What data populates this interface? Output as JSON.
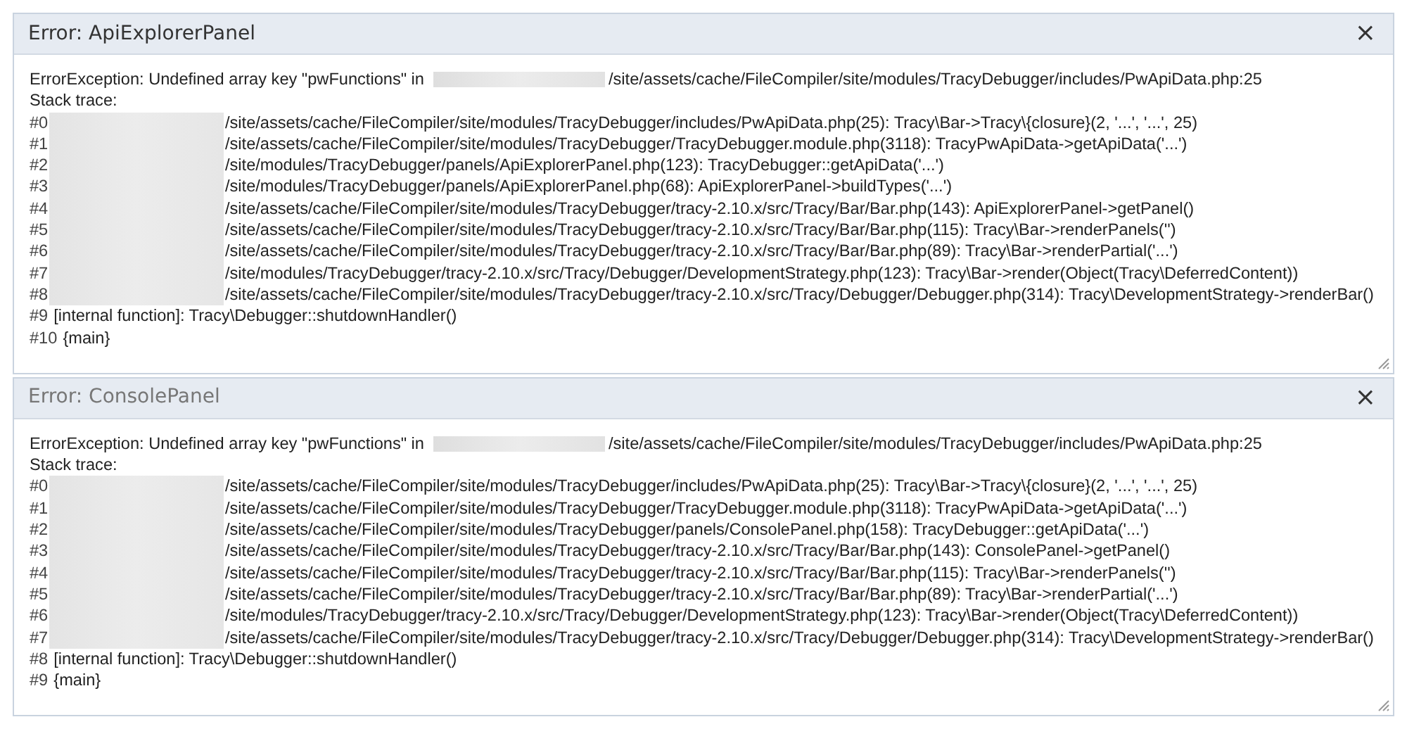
{
  "panels": [
    {
      "title": "Error: ApiExplorerPanel",
      "focused": true,
      "close": "×",
      "message_before": "ErrorException: Undefined array key \"pwFunctions\" in",
      "message_after": "/site/assets/cache/FileCompiler/site/modules/TracyDebugger/includes/PwApiData.php:25",
      "trace_heading": "Stack trace:",
      "frames": [
        {
          "number": "#0",
          "redacted": true,
          "text": "/site/assets/cache/FileCompiler/site/modules/TracyDebugger/includes/PwApiData.php(25): Tracy\\Bar->Tracy\\{closure}(2, '...', '...', 25)"
        },
        {
          "number": "#1",
          "redacted": true,
          "text": "/site/assets/cache/FileCompiler/site/modules/TracyDebugger/TracyDebugger.module.php(3118): TracyPwApiData->getApiData('...')"
        },
        {
          "number": "#2",
          "redacted": true,
          "text": "/site/modules/TracyDebugger/panels/ApiExplorerPanel.php(123): TracyDebugger::getApiData('...')"
        },
        {
          "number": "#3",
          "redacted": true,
          "text": "/site/modules/TracyDebugger/panels/ApiExplorerPanel.php(68): ApiExplorerPanel->buildTypes('...')"
        },
        {
          "number": "#4",
          "redacted": true,
          "text": "/site/assets/cache/FileCompiler/site/modules/TracyDebugger/tracy-2.10.x/src/Tracy/Bar/Bar.php(143): ApiExplorerPanel->getPanel()"
        },
        {
          "number": "#5",
          "redacted": true,
          "text": "/site/assets/cache/FileCompiler/site/modules/TracyDebugger/tracy-2.10.x/src/Tracy/Bar/Bar.php(115): Tracy\\Bar->renderPanels('')"
        },
        {
          "number": "#6",
          "redacted": true,
          "text": "/site/assets/cache/FileCompiler/site/modules/TracyDebugger/tracy-2.10.x/src/Tracy/Bar/Bar.php(89): Tracy\\Bar->renderPartial('...')"
        },
        {
          "number": "#7",
          "redacted": true,
          "text": "/site/modules/TracyDebugger/tracy-2.10.x/src/Tracy/Debugger/DevelopmentStrategy.php(123): Tracy\\Bar->render(Object(Tracy\\DeferredContent))"
        },
        {
          "number": "#8",
          "redacted": true,
          "text": "/site/assets/cache/FileCompiler/site/modules/TracyDebugger/tracy-2.10.x/src/Tracy/Debugger/Debugger.php(314): Tracy\\DevelopmentStrategy->renderBar()"
        },
        {
          "number": "#9",
          "redacted": false,
          "text": "[internal function]: Tracy\\Debugger::shutdownHandler()"
        },
        {
          "number": "#10",
          "redacted": false,
          "text": "{main}"
        }
      ]
    },
    {
      "title": "Error: ConsolePanel",
      "focused": false,
      "close": "×",
      "message_before": "ErrorException: Undefined array key \"pwFunctions\" in",
      "message_after": "/site/assets/cache/FileCompiler/site/modules/TracyDebugger/includes/PwApiData.php:25",
      "trace_heading": "Stack trace:",
      "frames": [
        {
          "number": "#0",
          "redacted": true,
          "text": "/site/assets/cache/FileCompiler/site/modules/TracyDebugger/includes/PwApiData.php(25): Tracy\\Bar->Tracy\\{closure}(2, '...', '...', 25)"
        },
        {
          "number": "#1",
          "redacted": true,
          "text": "/site/assets/cache/FileCompiler/site/modules/TracyDebugger/TracyDebugger.module.php(3118): TracyPwApiData->getApiData('...')"
        },
        {
          "number": "#2",
          "redacted": true,
          "text": "/site/assets/cache/FileCompiler/site/modules/TracyDebugger/panels/ConsolePanel.php(158): TracyDebugger::getApiData('...')"
        },
        {
          "number": "#3",
          "redacted": true,
          "text": "/site/assets/cache/FileCompiler/site/modules/TracyDebugger/tracy-2.10.x/src/Tracy/Bar/Bar.php(143): ConsolePanel->getPanel()"
        },
        {
          "number": "#4",
          "redacted": true,
          "text": "/site/assets/cache/FileCompiler/site/modules/TracyDebugger/tracy-2.10.x/src/Tracy/Bar/Bar.php(115): Tracy\\Bar->renderPanels('')"
        },
        {
          "number": "#5",
          "redacted": true,
          "text": "/site/assets/cache/FileCompiler/site/modules/TracyDebugger/tracy-2.10.x/src/Tracy/Bar/Bar.php(89): Tracy\\Bar->renderPartial('...')"
        },
        {
          "number": "#6",
          "redacted": true,
          "text": "/site/modules/TracyDebugger/tracy-2.10.x/src/Tracy/Debugger/DevelopmentStrategy.php(123): Tracy\\Bar->render(Object(Tracy\\DeferredContent))"
        },
        {
          "number": "#7",
          "redacted": true,
          "text": "/site/assets/cache/FileCompiler/site/modules/TracyDebugger/tracy-2.10.x/src/Tracy/Debugger/Debugger.php(314): Tracy\\DevelopmentStrategy->renderBar()"
        },
        {
          "number": "#8",
          "redacted": false,
          "text": "[internal function]: Tracy\\Debugger::shutdownHandler()"
        },
        {
          "number": "#9",
          "redacted": false,
          "text": "{main}"
        }
      ]
    }
  ]
}
